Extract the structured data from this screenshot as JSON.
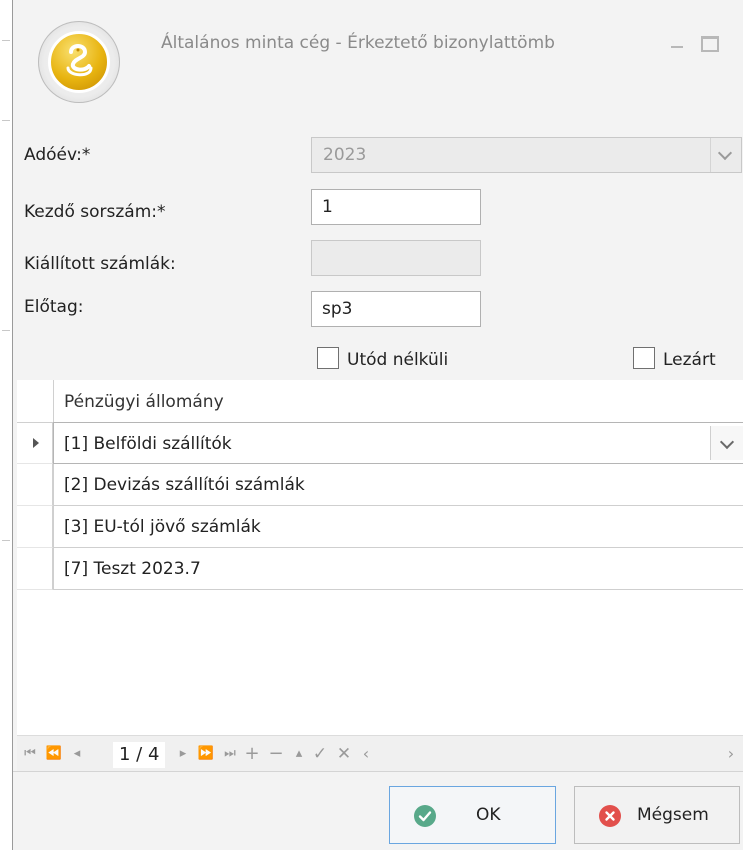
{
  "window": {
    "title": "Általános minta cég - Érkeztető bizonylattömb"
  },
  "form": {
    "adoev_label": "Adóév:*",
    "adoev_value": "2023",
    "kezdo_label": "Kezdő sorszám:*",
    "kezdo_value": "1",
    "kiallitott_label": "Kiállított számlák:",
    "kiallitott_value": "",
    "elotag_label": "Előtag:",
    "elotag_value": "sp3",
    "utod_label": "Utód nélküli",
    "lezart_label": "Lezárt"
  },
  "grid": {
    "column_header": "Pénzügyi állomány",
    "rows": [
      "[1] Belföldi szállítók",
      "[2] Devizás szállítói számlák",
      "[3] EU-tól jövő számlák",
      "[7] Teszt 2023.7"
    ]
  },
  "navigator": {
    "page": "1 / 4"
  },
  "buttons": {
    "ok_label": "OK",
    "cancel_label": "Mégsem"
  },
  "colors": {
    "ok_icon": "#58a98a",
    "cancel_icon": "#e2504c",
    "focus_border": "#6aa6e0"
  }
}
